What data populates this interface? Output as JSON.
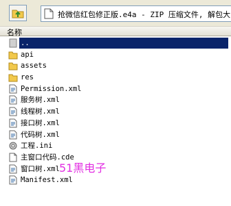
{
  "toolbar": {
    "up_icon": "folder-up-icon",
    "address_icon": "document-icon",
    "address_path": "抢微信红包修正版.e4a - ZIP 压缩文件, 解包大"
  },
  "header": {
    "column_name": "名称"
  },
  "files": [
    {
      "name": "..",
      "icon": "parent-folder-icon",
      "selected": true
    },
    {
      "name": "api",
      "icon": "folder-icon"
    },
    {
      "name": "assets",
      "icon": "folder-icon"
    },
    {
      "name": "res",
      "icon": "folder-icon"
    },
    {
      "name": "Permission.xml",
      "icon": "xml-file-icon"
    },
    {
      "name": "服务树.xml",
      "icon": "xml-file-icon"
    },
    {
      "name": "线程树.xml",
      "icon": "xml-file-icon"
    },
    {
      "name": "接口树.xml",
      "icon": "xml-file-icon"
    },
    {
      "name": "代码树.xml",
      "icon": "xml-file-icon"
    },
    {
      "name": "工程.ini",
      "icon": "ini-file-icon"
    },
    {
      "name": "主窗口代码.cde",
      "icon": "file-icon"
    },
    {
      "name": "窗口树.xml",
      "icon": "xml-file-icon"
    },
    {
      "name": "Manifest.xml",
      "icon": "xml-file-icon"
    }
  ],
  "watermark": "51黑电子",
  "colors": {
    "selection": "#0a246a",
    "folder": "#f2c94c",
    "watermark": "#e22fe2"
  }
}
